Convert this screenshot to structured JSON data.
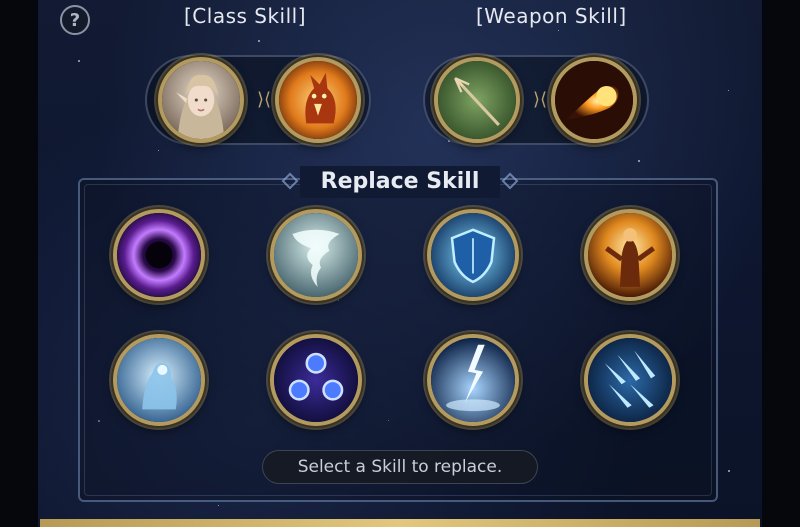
{
  "header": {
    "help_icon": "question-icon",
    "help_glyph": "?",
    "class_skill_title": "[Class Skill]",
    "weapon_skill_title": "[Weapon Skill]"
  },
  "class_skills": [
    {
      "icon": "elf-portrait-icon"
    },
    {
      "icon": "fire-dragon-icon"
    }
  ],
  "weapon_skills": [
    {
      "icon": "trident-icon"
    },
    {
      "icon": "fireball-icon"
    }
  ],
  "replace_panel": {
    "title": "Replace Skill",
    "skills": [
      {
        "icon": "dark-vortex-icon"
      },
      {
        "icon": "tornado-icon"
      },
      {
        "icon": "ice-shield-icon"
      },
      {
        "icon": "flame-warrior-icon"
      },
      {
        "icon": "frost-spirit-icon"
      },
      {
        "icon": "triple-orb-icon"
      },
      {
        "icon": "lightning-strike-icon"
      },
      {
        "icon": "ice-shards-icon"
      }
    ],
    "hint": "Select a Skill to replace."
  },
  "colors": {
    "frame_gold": "#b39b5f",
    "panel_border": "#7891be",
    "background": "#0e1730"
  }
}
